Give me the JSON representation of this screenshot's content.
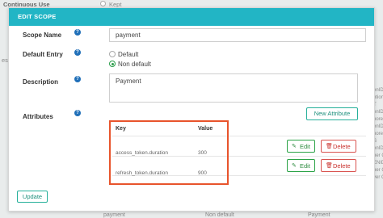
{
  "background": {
    "continuous_use_label": "Continuous Use",
    "kept_label": "Kept",
    "left_fragment": "es",
    "right_column_text": [
      "enID R",
      "ption ID",
      "T",
      "enID P",
      "hore D",
      "enID S",
      "hore I",
      "S",
      "enID C",
      "ner C",
      "ENID",
      "ner C",
      "ver C"
    ],
    "bottom_cells": [
      "payment",
      "Non default",
      "Payment"
    ]
  },
  "modal": {
    "title": "EDIT SCOPE",
    "scope_name_label": "Scope Name",
    "scope_name_value": "payment",
    "default_entry_label": "Default Entry",
    "default_option_label": "Default",
    "non_default_option_label": "Non default",
    "default_entry_selected": "Non default",
    "description_label": "Description",
    "description_value": "Payment",
    "attributes_label": "Attributes",
    "new_attribute_label": "New Attribute",
    "help_glyph": "?",
    "attributes_table": {
      "headers": [
        "Key",
        "Value"
      ],
      "rows": [
        {
          "key": "access_token.duration",
          "value": "300"
        },
        {
          "key": "refresh_token.duration",
          "value": "900"
        }
      ],
      "edit_label": "Edit",
      "delete_label": "Delete"
    },
    "update_label": "Update"
  },
  "icons": {
    "edit_icon": "pencil-square-icon",
    "delete_icon": "trash-icon",
    "help_icon": "question-circle-icon"
  },
  "colors": {
    "header_bg": "#22b5c5",
    "highlight_border": "#e8542c",
    "edit_green": "#2aa245",
    "delete_red": "#d9534f",
    "outline_teal": "#26b09a",
    "help_blue": "#1f6fb8"
  }
}
